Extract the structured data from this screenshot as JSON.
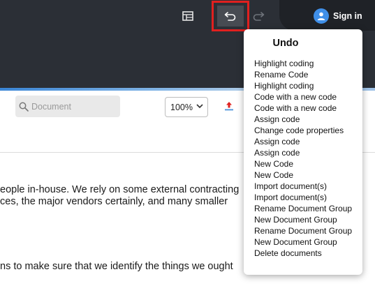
{
  "toolbar": {
    "sign_in_label": "Sign in",
    "icons": [
      "table-icon",
      "undo-icon",
      "redo-icon",
      "user-avatar-icon"
    ]
  },
  "document_toolbar": {
    "search_placeholder": "Document",
    "zoom_value": "100%",
    "upload_icon": "upload-icon"
  },
  "document": {
    "lines": [
      "eople in-house.  We rely on some external contracting",
      "ces, the major vendors certainly, and many smaller",
      "ns to make sure that we identify the things we ought"
    ]
  },
  "undo_menu": {
    "title": "Undo",
    "items": [
      "Highlight coding",
      "Rename Code",
      "Highlight coding",
      "Code with a new code",
      "Code with a new code",
      "Assign code",
      "Change code properties",
      "Assign code",
      "Assign code",
      "New Code",
      "New Code",
      "Import document(s)",
      "Import document(s)",
      "Rename Document Group",
      "New Document Group",
      "Rename Document Group",
      "New Document Group",
      "Delete documents"
    ]
  },
  "colors": {
    "topbar": "#2b2f36",
    "highlight_border": "#e0201f",
    "accent_blue": "#3f8fe8",
    "upload_red": "#e0201f"
  }
}
